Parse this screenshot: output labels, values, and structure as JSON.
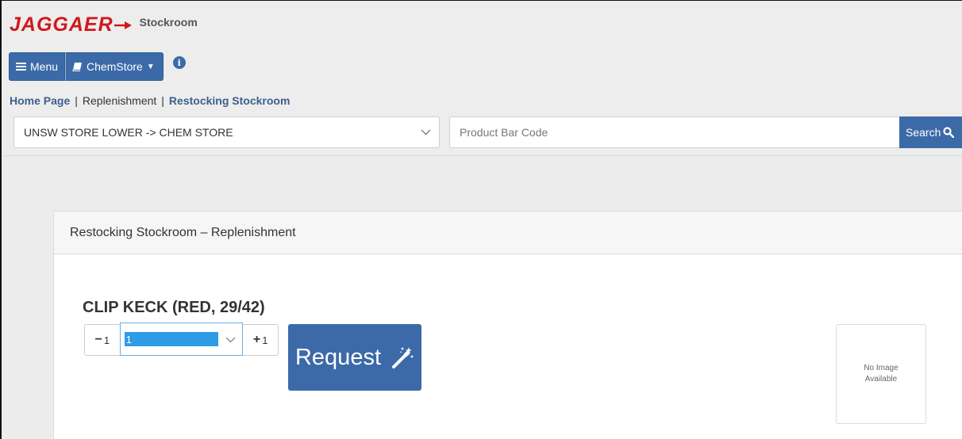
{
  "app": {
    "logo_text": "JAGGAER",
    "name": "Stockroom"
  },
  "nav": {
    "menu_label": "Menu",
    "store_label": "ChemStore",
    "info_icon": "info-circle-icon"
  },
  "breadcrumb": {
    "items": [
      "Home Page",
      "Replenishment",
      "Restocking Stockroom"
    ],
    "separator": "|"
  },
  "toolbar": {
    "store_selected": "UNSW STORE LOWER -> CHEM STORE",
    "barcode_placeholder": "Product Bar Code",
    "search_label": "Search"
  },
  "panel": {
    "heading": "Restocking Stockroom – Replenishment"
  },
  "product": {
    "title": "CLIP KECK (RED, 29/42)",
    "minus_label": "1",
    "quantity_selected": "1",
    "plus_label": "1",
    "request_label": "Request",
    "no_image_line1": "No Image",
    "no_image_line2": "Available"
  },
  "colors": {
    "brand_red": "#d0181b",
    "primary_blue": "#3c6aa8",
    "select_highlight": "#2e9be6"
  }
}
